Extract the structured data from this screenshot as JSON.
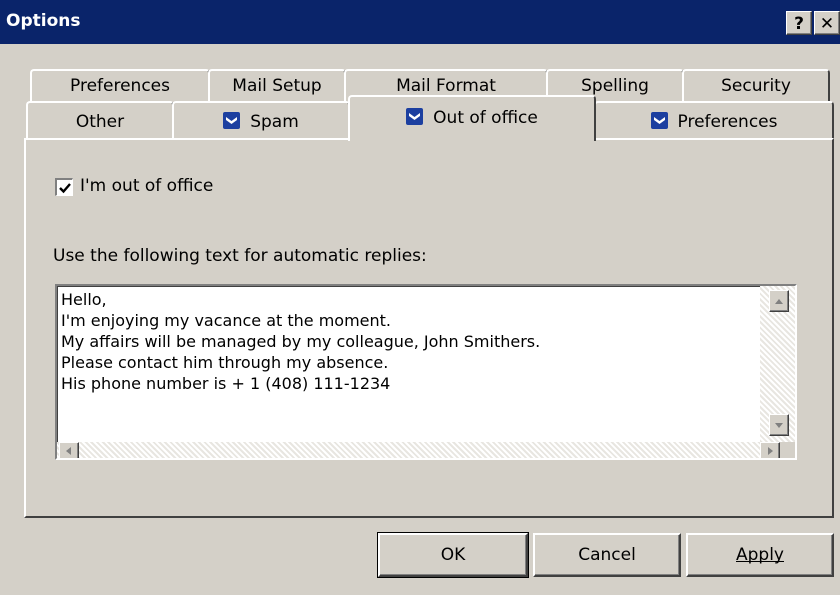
{
  "window": {
    "title": "Options",
    "help_label": "?",
    "close_label": "✕"
  },
  "tabs": {
    "row1": [
      {
        "label": "Preferences"
      },
      {
        "label": "Mail Setup"
      },
      {
        "label": "Mail Format"
      },
      {
        "label": "Spelling"
      },
      {
        "label": "Security"
      }
    ],
    "row2": [
      {
        "label": "Other",
        "icon": null
      },
      {
        "label": "Spam",
        "icon": "chevron-shield-icon"
      },
      {
        "label": "Out of office",
        "icon": "chevron-shield-icon",
        "active": true
      },
      {
        "label": "Preferences",
        "icon": "chevron-shield-icon"
      }
    ]
  },
  "out_of_office": {
    "checkbox_label": "I'm out of office",
    "checkbox_checked": true,
    "replies_label": "Use the following text for automatic replies:",
    "reply_text": "Hello,\nI'm enjoying my vacance at the moment.\nMy affairs will be managed by my colleague, John Smithers.\nPlease contact him through my absence.\nHis phone number is + 1 (408) 111-1234"
  },
  "buttons": {
    "ok": "OK",
    "cancel": "Cancel",
    "apply": "Apply"
  },
  "colors": {
    "title_bar": "#0a246a",
    "dialog_bg": "#d4d0c8",
    "icon_blue": "#1c3fa0"
  }
}
